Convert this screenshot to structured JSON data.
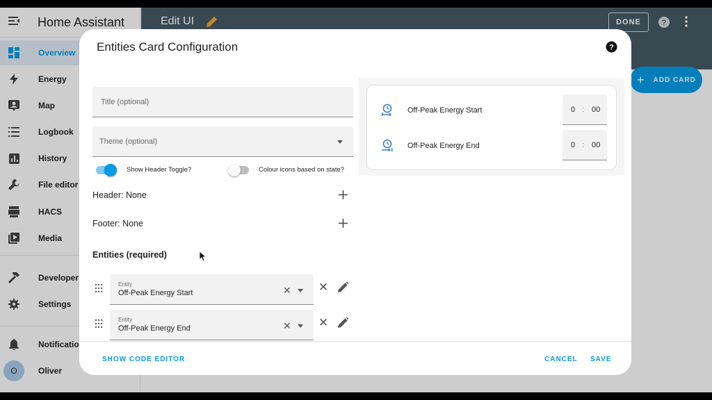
{
  "app": {
    "title": "Home Assistant"
  },
  "sidebar": {
    "items": [
      {
        "label": "Overview",
        "icon": "dashboard-icon"
      },
      {
        "label": "Energy",
        "icon": "lightning-icon"
      },
      {
        "label": "Map",
        "icon": "map-icon"
      },
      {
        "label": "Logbook",
        "icon": "list-icon"
      },
      {
        "label": "History",
        "icon": "chart-icon"
      },
      {
        "label": "File editor",
        "icon": "wrench-icon"
      },
      {
        "label": "HACS",
        "icon": "hacs-icon"
      },
      {
        "label": "Media",
        "icon": "media-icon"
      },
      {
        "label": "Developer T",
        "icon": "hammer-icon"
      },
      {
        "label": "Settings",
        "icon": "gear-icon"
      },
      {
        "label": "Notification",
        "icon": "bell-icon"
      },
      {
        "label": "Oliver",
        "icon": "avatar"
      }
    ],
    "avatar_initial": "O"
  },
  "topbar": {
    "title": "Edit UI",
    "done_label": "DONE",
    "add_card_label": "ADD CARD"
  },
  "dialog": {
    "title": "Entities Card Configuration",
    "title_placeholder": "Title (optional)",
    "theme_placeholder": "Theme (optional)",
    "toggle_header_label": "Show Header Toggle?",
    "toggle_header_on": true,
    "toggle_colour_label": "Colour icons based on state?",
    "toggle_colour_on": false,
    "header_label": "Header: None",
    "footer_label": "Footer: None",
    "entities_label": "Entities (required)",
    "entities": [
      {
        "field_label": "Entity",
        "value": "Off-Peak Energy Start"
      },
      {
        "field_label": "Entity",
        "value": "Off-Peak Energy End"
      }
    ],
    "show_code_editor": "SHOW CODE EDITOR",
    "cancel": "CANCEL",
    "save": "SAVE"
  },
  "preview": {
    "rows": [
      {
        "name": "Off-Peak Energy Start",
        "hours": "0",
        "sep": ":",
        "minutes": "00"
      },
      {
        "name": "Off-Peak Energy End",
        "hours": "0",
        "sep": ":",
        "minutes": "00"
      }
    ]
  },
  "colors": {
    "accent": "#039be5",
    "topbar": "#455a64"
  }
}
